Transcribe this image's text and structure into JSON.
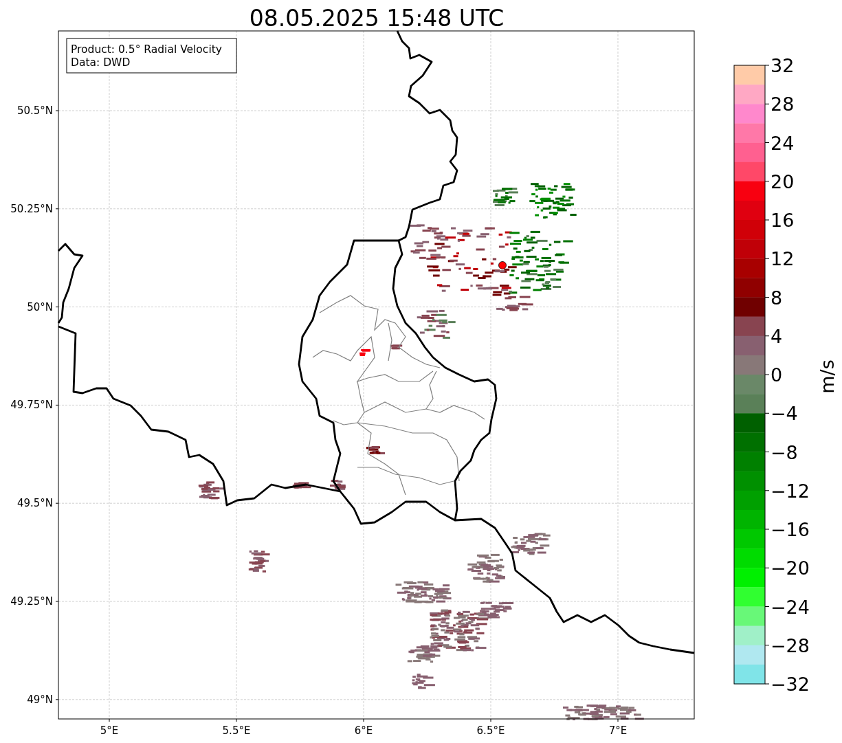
{
  "title": "08.05.2025 15:48 UTC",
  "map": {
    "x_ticks": [
      "5°E",
      "5.5°E",
      "6°E",
      "6.5°E",
      "7°E"
    ],
    "y_ticks": [
      "50.5°N",
      "50.25°N",
      "50°N",
      "49.75°N",
      "49.5°N",
      "49.25°N",
      "49°N"
    ],
    "info_box": [
      "Product: 0.5° Radial Velocity",
      "Data: DWD"
    ]
  },
  "colorbar": {
    "label": "m/s",
    "ticks": [
      "32",
      "28",
      "24",
      "20",
      "16",
      "12",
      "8",
      "4",
      "0",
      "−4",
      "−8",
      "−12",
      "−16",
      "−20",
      "−24",
      "−28",
      "−32"
    ],
    "bands": [
      {
        "color": "#ffcba8"
      },
      {
        "color": "#ffa8c4"
      },
      {
        "color": "#ff88cc"
      },
      {
        "color": "#ff78a8"
      },
      {
        "color": "#ff6090"
      },
      {
        "color": "#ff4868"
      },
      {
        "color": "#f80010"
      },
      {
        "color": "#e00010"
      },
      {
        "color": "#d00008"
      },
      {
        "color": "#c00008"
      },
      {
        "color": "#a80000"
      },
      {
        "color": "#900000"
      },
      {
        "color": "#700000"
      },
      {
        "color": "#884450"
      },
      {
        "color": "#886070"
      },
      {
        "color": "#887878"
      },
      {
        "color": "#6a8868"
      },
      {
        "color": "#5a8058"
      },
      {
        "color": "#006000"
      },
      {
        "color": "#007000"
      },
      {
        "color": "#008000"
      },
      {
        "color": "#009000"
      },
      {
        "color": "#00a000"
      },
      {
        "color": "#00b400"
      },
      {
        "color": "#00c800"
      },
      {
        "color": "#00dc00"
      },
      {
        "color": "#00f000"
      },
      {
        "color": "#30ff30"
      },
      {
        "color": "#68f878"
      },
      {
        "color": "#a0f0c8"
      },
      {
        "color": "#b0e8f0"
      },
      {
        "color": "#80e4e8"
      }
    ]
  }
}
